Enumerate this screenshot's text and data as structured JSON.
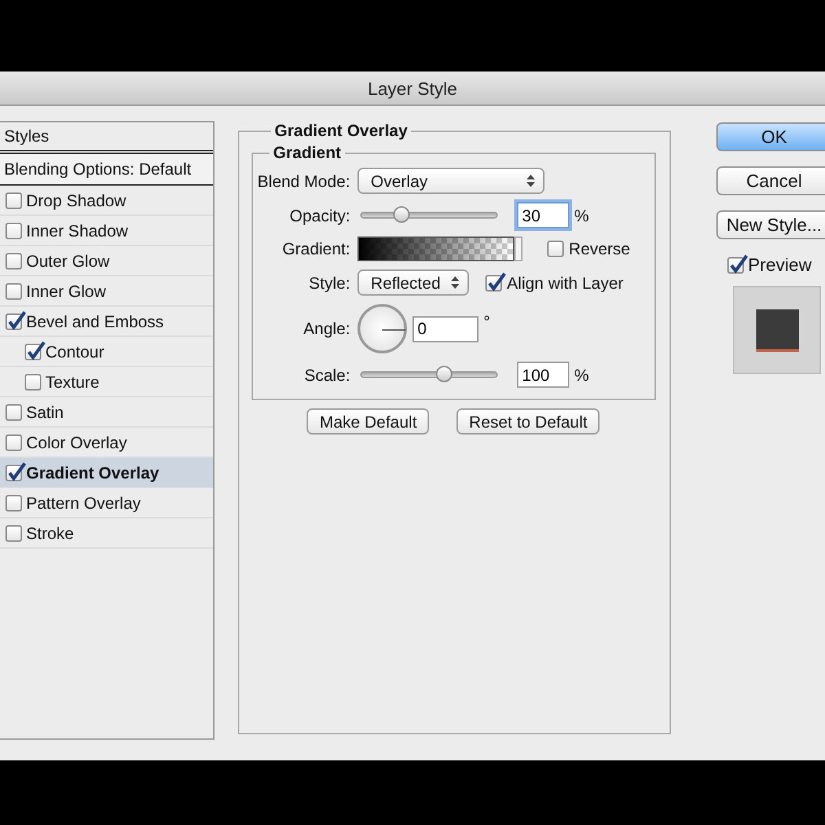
{
  "window": {
    "title": "Layer Style"
  },
  "styles_panel": {
    "header": "Styles",
    "blending_options": "Blending Options: Default",
    "items": [
      {
        "label": "Drop Shadow",
        "checked": false,
        "selected": false
      },
      {
        "label": "Inner Shadow",
        "checked": false,
        "selected": false
      },
      {
        "label": "Outer Glow",
        "checked": false,
        "selected": false
      },
      {
        "label": "Inner Glow",
        "checked": false,
        "selected": false
      },
      {
        "label": "Bevel and Emboss",
        "checked": true,
        "selected": false,
        "children": [
          {
            "label": "Contour",
            "checked": true,
            "selected": false
          },
          {
            "label": "Texture",
            "checked": false,
            "selected": false
          }
        ]
      },
      {
        "label": "Satin",
        "checked": false,
        "selected": false
      },
      {
        "label": "Color Overlay",
        "checked": false,
        "selected": false
      },
      {
        "label": "Gradient Overlay",
        "checked": true,
        "selected": true
      },
      {
        "label": "Pattern Overlay",
        "checked": false,
        "selected": false
      },
      {
        "label": "Stroke",
        "checked": false,
        "selected": false
      }
    ]
  },
  "gradient_overlay": {
    "title": "Gradient Overlay",
    "group_title": "Gradient",
    "blend_mode": {
      "label": "Blend Mode:",
      "value": "Overlay"
    },
    "opacity": {
      "label": "Opacity:",
      "level": 0.3,
      "value": "30",
      "unit": "%",
      "focused": true
    },
    "gradient": {
      "label": "Gradient:"
    },
    "reverse": {
      "label": "Reverse",
      "checked": false
    },
    "style": {
      "label": "Style:",
      "value": "Reflected"
    },
    "align_with_layer": {
      "label": "Align with Layer",
      "checked": true
    },
    "angle": {
      "label": "Angle:",
      "value": "0",
      "unit": "°"
    },
    "scale": {
      "label": "Scale:",
      "level": 0.62,
      "value": "100",
      "unit": "%"
    },
    "buttons": [
      "Make Default",
      "Reset to Default"
    ]
  },
  "actions": [
    {
      "label": "OK",
      "default": true
    },
    {
      "label": "Cancel",
      "default": false
    },
    {
      "label": "New Style...",
      "default": false
    }
  ],
  "preview": {
    "label": "Preview",
    "checked": true
  }
}
